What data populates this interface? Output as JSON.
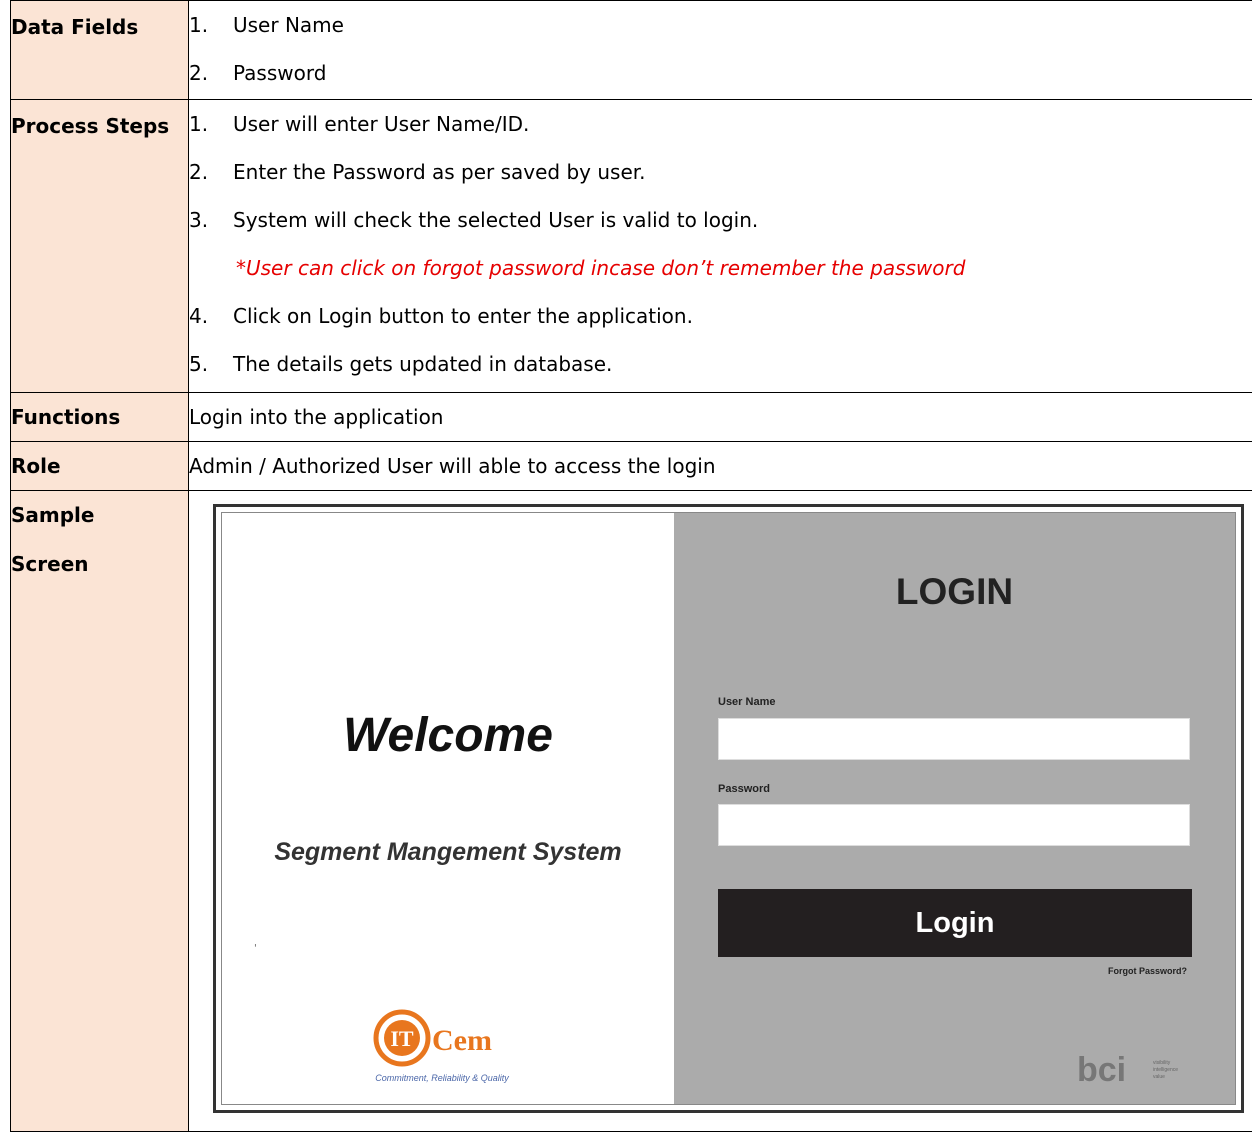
{
  "rows": {
    "data_fields": {
      "label": "Data Fields",
      "items": [
        {
          "num": "1.",
          "text": "User Name"
        },
        {
          "num": "2.",
          "text": "Password"
        }
      ]
    },
    "process_steps": {
      "label": "Process Steps",
      "items": [
        {
          "num": "1.",
          "text": "User will enter User Name/ID."
        },
        {
          "num": "2.",
          "text": "Enter the Password as per saved by user."
        },
        {
          "num": "3.",
          "text": "System will check the selected User is valid to login."
        },
        {
          "num": "4.",
          "text": "Click on Login button to enter the application."
        },
        {
          "num": "5.",
          "text": "The details gets updated in database."
        }
      ],
      "note": "*User can click on forgot password incase don’t remember the password"
    },
    "functions": {
      "label": "Functions",
      "text": "Login into the application"
    },
    "role": {
      "label": "Role",
      "text": "Admin / Authorized User will able to access the login"
    },
    "sample": {
      "label_line1": "Sample",
      "label_line2": "Screen"
    }
  },
  "sample_screen": {
    "welcome": "Welcome",
    "subtitle": "Segment Mangement System",
    "tick": "'",
    "logo_text": "Cem",
    "logo_letters": "IT",
    "logo_tagline": "Commitment, Reliability & Quality",
    "login_title": "LOGIN",
    "username_label": "User Name",
    "password_label": "Password",
    "login_button": "Login",
    "forgot_link": "Forgot Password?",
    "bci_logo_text": "bci",
    "bci_tagline": [
      "visibility",
      "intelligence",
      "value"
    ],
    "colors": {
      "left_bg": "#ffffff",
      "right_bg": "#ababab",
      "button_bg": "#231f20",
      "logo_orange": "#e8761e",
      "label_bg": "#fbe4d5",
      "note_red": "#e60000"
    }
  }
}
